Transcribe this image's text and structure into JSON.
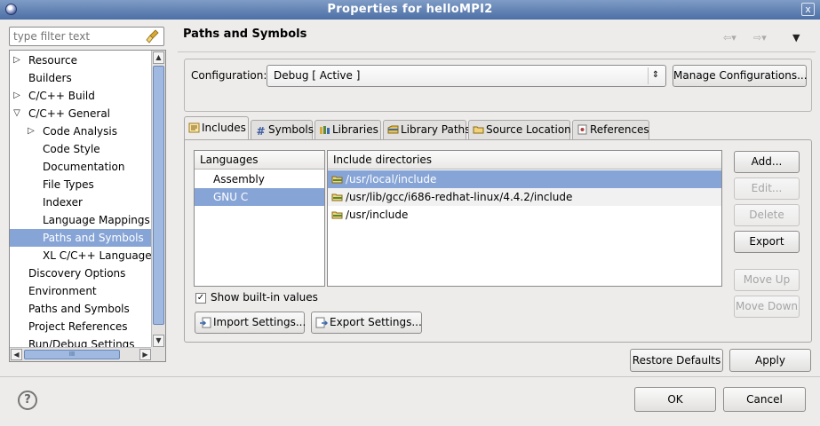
{
  "window": {
    "title": "Properties for helloMPI2",
    "close_glyph": "x"
  },
  "filter": {
    "placeholder": "type filter text"
  },
  "tree": {
    "items": [
      {
        "label": "Resource",
        "twisty": "▷"
      },
      {
        "label": "Builders",
        "twisty": ""
      },
      {
        "label": "C/C++ Build",
        "twisty": "▷"
      },
      {
        "label": "C/C++ General",
        "twisty": "▽"
      },
      {
        "label": "Code Analysis",
        "twisty": "▷"
      },
      {
        "label": "Code Style",
        "twisty": ""
      },
      {
        "label": "Documentation",
        "twisty": ""
      },
      {
        "label": "File Types",
        "twisty": ""
      },
      {
        "label": "Indexer",
        "twisty": ""
      },
      {
        "label": "Language Mappings",
        "twisty": ""
      },
      {
        "label": "Paths and Symbols",
        "twisty": "",
        "selected": true
      },
      {
        "label": "XL C/C++ Language ...",
        "twisty": ""
      },
      {
        "label": "Discovery Options",
        "twisty": ""
      },
      {
        "label": "Environment",
        "twisty": ""
      },
      {
        "label": "Paths and Symbols",
        "twisty": ""
      },
      {
        "label": "Project References",
        "twisty": ""
      },
      {
        "label": "Run/Debug Settings",
        "twisty": ""
      }
    ],
    "hscroll_thumb_grip": "III"
  },
  "page": {
    "title": "Paths and Symbols",
    "configuration_label": "Configuration:",
    "configuration_value": "Debug  [ Active ]",
    "manage_button": "Manage Configurations...",
    "tabs": [
      {
        "label": "Includes",
        "icon": "includes-icon",
        "active": true
      },
      {
        "label": "Symbols",
        "icon": "hash-icon"
      },
      {
        "label": "Libraries",
        "icon": "libraries-icon"
      },
      {
        "label": "Library Paths",
        "icon": "library-paths-icon"
      },
      {
        "label": "Source Location",
        "icon": "folder-icon"
      },
      {
        "label": "References",
        "icon": "references-icon"
      }
    ],
    "languages_header": "Languages",
    "languages": [
      {
        "label": "Assembly"
      },
      {
        "label": "GNU C",
        "selected": true
      }
    ],
    "includes_header": "Include directories",
    "includes": [
      {
        "path": "/usr/local/include",
        "selected": true
      },
      {
        "path": "/usr/lib/gcc/i686-redhat-linux/4.4.2/include"
      },
      {
        "path": "/usr/include"
      }
    ],
    "side_buttons": {
      "add": "Add...",
      "edit": "Edit...",
      "delete": "Delete",
      "export": "Export",
      "move_up": "Move Up",
      "move_down": "Move Down"
    },
    "show_builtin_label": "Show built-in values",
    "show_builtin_checked": "✓",
    "import_settings": "Import Settings...",
    "export_settings": "Export Settings...",
    "restore_defaults": "Restore Defaults",
    "apply": "Apply"
  },
  "footer": {
    "help": "?",
    "ok": "OK",
    "cancel": "Cancel"
  },
  "colors": {
    "selection": "#86a4d6",
    "titlebar": "#5d7db0",
    "dialog_bg": "#edeceb"
  }
}
